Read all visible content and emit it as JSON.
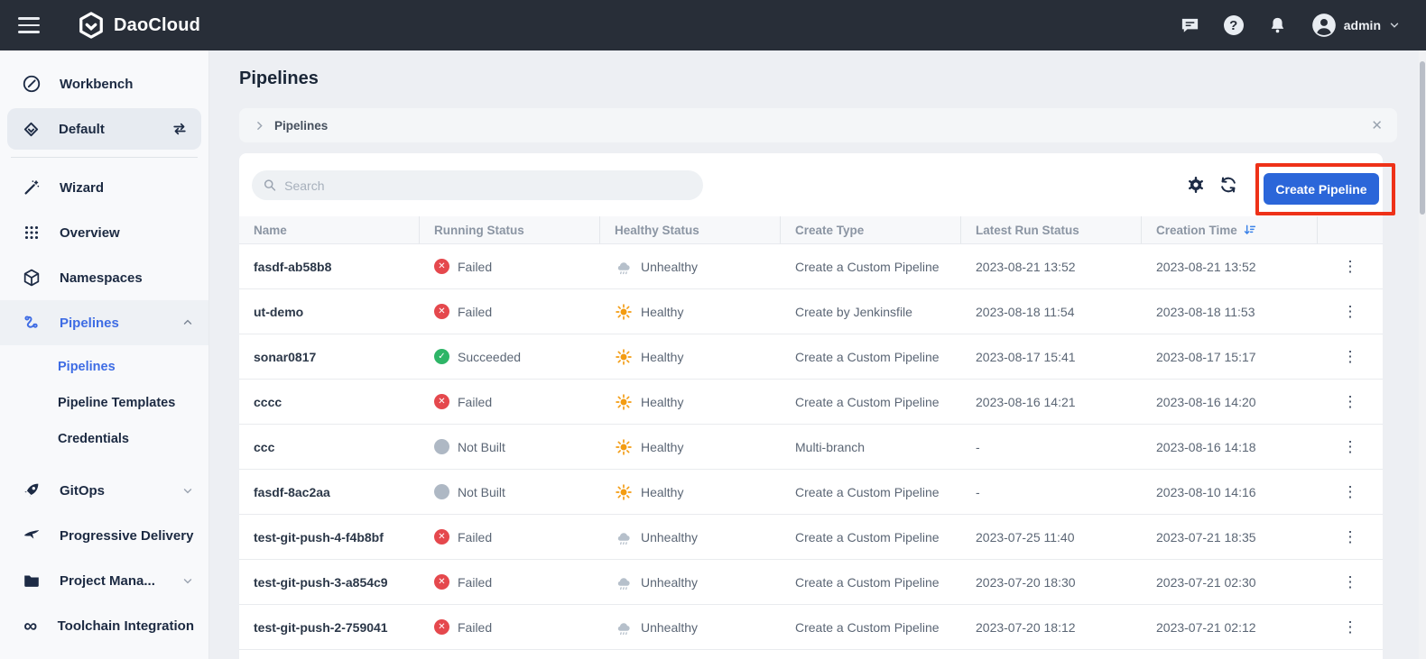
{
  "header": {
    "brand": "DaoCloud",
    "user": "admin"
  },
  "sidebar": {
    "items": [
      {
        "label": "Workbench"
      },
      {
        "label": "Default"
      },
      {
        "label": "Wizard"
      },
      {
        "label": "Overview"
      },
      {
        "label": "Namespaces"
      },
      {
        "label": "Pipelines"
      },
      {
        "label": "GitOps"
      },
      {
        "label": "Progressive Delivery"
      },
      {
        "label": "Project Mana..."
      },
      {
        "label": "Toolchain Integration"
      }
    ],
    "pipeline_children": [
      {
        "label": "Pipelines"
      },
      {
        "label": "Pipeline Templates"
      },
      {
        "label": "Credentials"
      }
    ]
  },
  "page": {
    "title": "Pipelines",
    "breadcrumb": "Pipelines"
  },
  "toolbar": {
    "search_placeholder": "Search",
    "create_button": "Create Pipeline"
  },
  "table": {
    "columns": [
      {
        "label": "Name"
      },
      {
        "label": "Running Status"
      },
      {
        "label": "Healthy Status"
      },
      {
        "label": "Create Type"
      },
      {
        "label": "Latest Run Status"
      },
      {
        "label": "Creation Time"
      }
    ],
    "sorted_by": "Creation Time",
    "status_glyphs": {
      "failed": "✕",
      "succeeded": "✓",
      "notbuilt": ""
    },
    "rows": [
      {
        "name": "fasdf-ab58b8",
        "running_status": "Failed",
        "running_icon": "failed",
        "healthy_status": "Unhealthy",
        "healthy_icon": "unhealthy",
        "create_type": "Create a Custom Pipeline",
        "latest_run": "2023-08-21 13:52",
        "created": "2023-08-21 13:52"
      },
      {
        "name": "ut-demo",
        "running_status": "Failed",
        "running_icon": "failed",
        "healthy_status": "Healthy",
        "healthy_icon": "healthy",
        "create_type": "Create by Jenkinsfile",
        "latest_run": "2023-08-18 11:54",
        "created": "2023-08-18 11:53"
      },
      {
        "name": "sonar0817",
        "running_status": "Succeeded",
        "running_icon": "succeeded",
        "healthy_status": "Healthy",
        "healthy_icon": "healthy",
        "create_type": "Create a Custom Pipeline",
        "latest_run": "2023-08-17 15:41",
        "created": "2023-08-17 15:17"
      },
      {
        "name": "cccc",
        "running_status": "Failed",
        "running_icon": "failed",
        "healthy_status": "Healthy",
        "healthy_icon": "healthy",
        "create_type": "Create a Custom Pipeline",
        "latest_run": "2023-08-16 14:21",
        "created": "2023-08-16 14:20"
      },
      {
        "name": "ccc",
        "running_status": "Not Built",
        "running_icon": "notbuilt",
        "healthy_status": "Healthy",
        "healthy_icon": "healthy",
        "create_type": "Multi-branch",
        "latest_run": "-",
        "created": "2023-08-16 14:18"
      },
      {
        "name": "fasdf-8ac2aa",
        "running_status": "Not Built",
        "running_icon": "notbuilt",
        "healthy_status": "Healthy",
        "healthy_icon": "healthy",
        "create_type": "Create a Custom Pipeline",
        "latest_run": "-",
        "created": "2023-08-10 14:16"
      },
      {
        "name": "test-git-push-4-f4b8bf",
        "running_status": "Failed",
        "running_icon": "failed",
        "healthy_status": "Unhealthy",
        "healthy_icon": "unhealthy",
        "create_type": "Create a Custom Pipeline",
        "latest_run": "2023-07-25 11:40",
        "created": "2023-07-21 18:35"
      },
      {
        "name": "test-git-push-3-a854c9",
        "running_status": "Failed",
        "running_icon": "failed",
        "healthy_status": "Unhealthy",
        "healthy_icon": "unhealthy",
        "create_type": "Create a Custom Pipeline",
        "latest_run": "2023-07-20 18:30",
        "created": "2023-07-21 02:30"
      },
      {
        "name": "test-git-push-2-759041",
        "running_status": "Failed",
        "running_icon": "failed",
        "healthy_status": "Unhealthy",
        "healthy_icon": "unhealthy",
        "create_type": "Create a Custom Pipeline",
        "latest_run": "2023-07-20 18:12",
        "created": "2023-07-21 02:12"
      }
    ]
  },
  "glyphs": {
    "kebab": "⋮",
    "close": "✕",
    "help": "?",
    "infinity": "∞"
  },
  "colors": {
    "accent_blue": "#2b66d9",
    "annotation_red": "#ee3118",
    "failed_red": "#e5484d",
    "succeeded_green": "#2eb567",
    "not_built_gray": "#aeb8c4",
    "healthy_amber": "#f39c12",
    "unhealthy_gray": "#b6c0cb",
    "active_link": "#3e6ce4"
  }
}
